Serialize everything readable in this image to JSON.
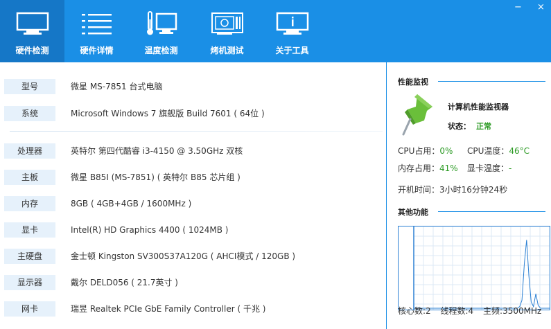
{
  "toolbar": {
    "tabs": [
      {
        "label": "硬件检测",
        "icon": "monitor-icon"
      },
      {
        "label": "硬件详情",
        "icon": "list-icon"
      },
      {
        "label": "温度检测",
        "icon": "thermometer-monitor-icon"
      },
      {
        "label": "烤机测试",
        "icon": "graphics-card-icon"
      },
      {
        "label": "关于工具",
        "icon": "info-monitor-icon"
      }
    ],
    "active_tab": "硬件检测",
    "minimize": "−",
    "close": "×"
  },
  "hardware": {
    "model": {
      "label": "型号",
      "value": "微星 MS-7851 台式电脑"
    },
    "os": {
      "label": "系统",
      "value": "Microsoft Windows 7 旗舰版 Build 7601 ( 64位 )"
    },
    "cpu": {
      "label": "处理器",
      "value": "英特尔 第四代酷睿 i3-4150 @ 3.50GHz 双核"
    },
    "board": {
      "label": "主板",
      "value": "微星 B85I (MS-7851) ( 英特尔 B85 芯片组 )"
    },
    "memory": {
      "label": "内存",
      "value": "8GB ( 4GB+4GB / 1600MHz )"
    },
    "gpu": {
      "label": "显卡",
      "value": "Intel(R) HD Graphics 4400 ( 1024MB )"
    },
    "disk": {
      "label": "主硬盘",
      "value": "金士顿 Kingston SV300S37A120G ( AHCI模式 / 120GB )"
    },
    "display": {
      "label": "显示器",
      "value": "戴尔 DELD056 ( 21.7英寸 )"
    },
    "nic": {
      "label": "网卡",
      "value": "瑞昱 Realtek PCIe GbE Family Controller ( 千兆 )"
    }
  },
  "monitor": {
    "section_title": "性能监视",
    "title": "计算机性能监视器",
    "state_label": "状态：",
    "state_value": "正常",
    "cpu_usage_label": "CPU占用：",
    "cpu_usage": "0%",
    "cpu_temp_label": "CPU温度：",
    "cpu_temp": "46°C",
    "mem_usage_label": "内存占用：",
    "mem_usage": "41%",
    "gpu_temp_label": "显卡温度：",
    "gpu_temp": "-",
    "uptime_label": "开机时间：",
    "uptime": "3小时16分钟24秒",
    "icon": "pushpin-icon",
    "colors": {
      "accent": "#1a8fe6",
      "ok": "#2b9a23",
      "pin": "#6abf3a"
    }
  },
  "other": {
    "section_title": "其他功能",
    "cores": "核心数:2",
    "threads": "线程数:4",
    "freq": "主频:3500MHz",
    "graph": {
      "type": "line",
      "points": [
        0,
        0,
        0,
        0,
        0,
        0,
        0,
        0,
        0,
        0,
        0,
        0,
        0,
        0,
        0,
        0,
        0,
        0,
        0,
        0,
        0,
        0,
        0,
        0,
        0,
        0,
        0,
        0,
        0,
        0,
        0,
        0,
        0,
        0,
        0,
        0,
        0,
        0,
        0,
        0,
        0,
        0,
        0,
        0,
        0,
        0,
        2,
        10,
        55,
        85,
        40,
        8,
        2,
        18,
        4,
        0,
        0,
        0,
        0,
        0
      ]
    }
  }
}
